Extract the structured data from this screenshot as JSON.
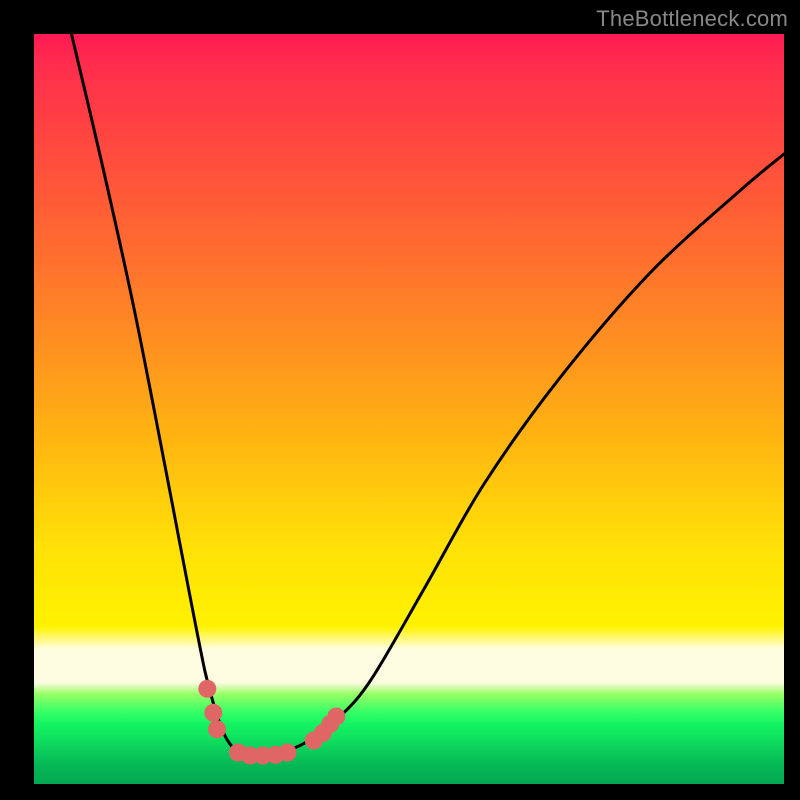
{
  "watermark": "TheBottleneck.com",
  "chart_data": {
    "type": "line",
    "title": "",
    "xlabel": "",
    "ylabel": "",
    "xlim": [
      0,
      1
    ],
    "ylim": [
      0,
      1
    ],
    "series": [
      {
        "name": "curve",
        "x": [
          0.05,
          0.09,
          0.13,
          0.16,
          0.185,
          0.21,
          0.228,
          0.24,
          0.252,
          0.264,
          0.278,
          0.298,
          0.338,
          0.37,
          0.408,
          0.45,
          0.52,
          0.6,
          0.7,
          0.82,
          0.94,
          1.0
        ],
        "y": [
          1.0,
          0.83,
          0.65,
          0.5,
          0.37,
          0.24,
          0.15,
          0.105,
          0.07,
          0.05,
          0.04,
          0.04,
          0.045,
          0.06,
          0.09,
          0.14,
          0.26,
          0.4,
          0.54,
          0.68,
          0.79,
          0.84
        ]
      }
    ],
    "markers": [
      {
        "x": 0.231,
        "y": 0.127
      },
      {
        "x": 0.239,
        "y": 0.095
      },
      {
        "x": 0.244,
        "y": 0.073
      },
      {
        "x": 0.272,
        "y": 0.042
      },
      {
        "x": 0.288,
        "y": 0.038
      },
      {
        "x": 0.305,
        "y": 0.038
      },
      {
        "x": 0.322,
        "y": 0.039
      },
      {
        "x": 0.338,
        "y": 0.042
      },
      {
        "x": 0.373,
        "y": 0.058
      },
      {
        "x": 0.385,
        "y": 0.068
      },
      {
        "x": 0.395,
        "y": 0.08
      },
      {
        "x": 0.403,
        "y": 0.09
      }
    ],
    "marker_style": {
      "color": "#e06666",
      "radius_px": 9
    },
    "gradient_stops": [
      {
        "pos": 0.0,
        "color": "#ff1a53"
      },
      {
        "pos": 0.5,
        "color": "#ffb810"
      },
      {
        "pos": 0.8,
        "color": "#fff200"
      },
      {
        "pos": 0.9,
        "color": "#32ff66"
      },
      {
        "pos": 1.0,
        "color": "#03a851"
      }
    ]
  }
}
